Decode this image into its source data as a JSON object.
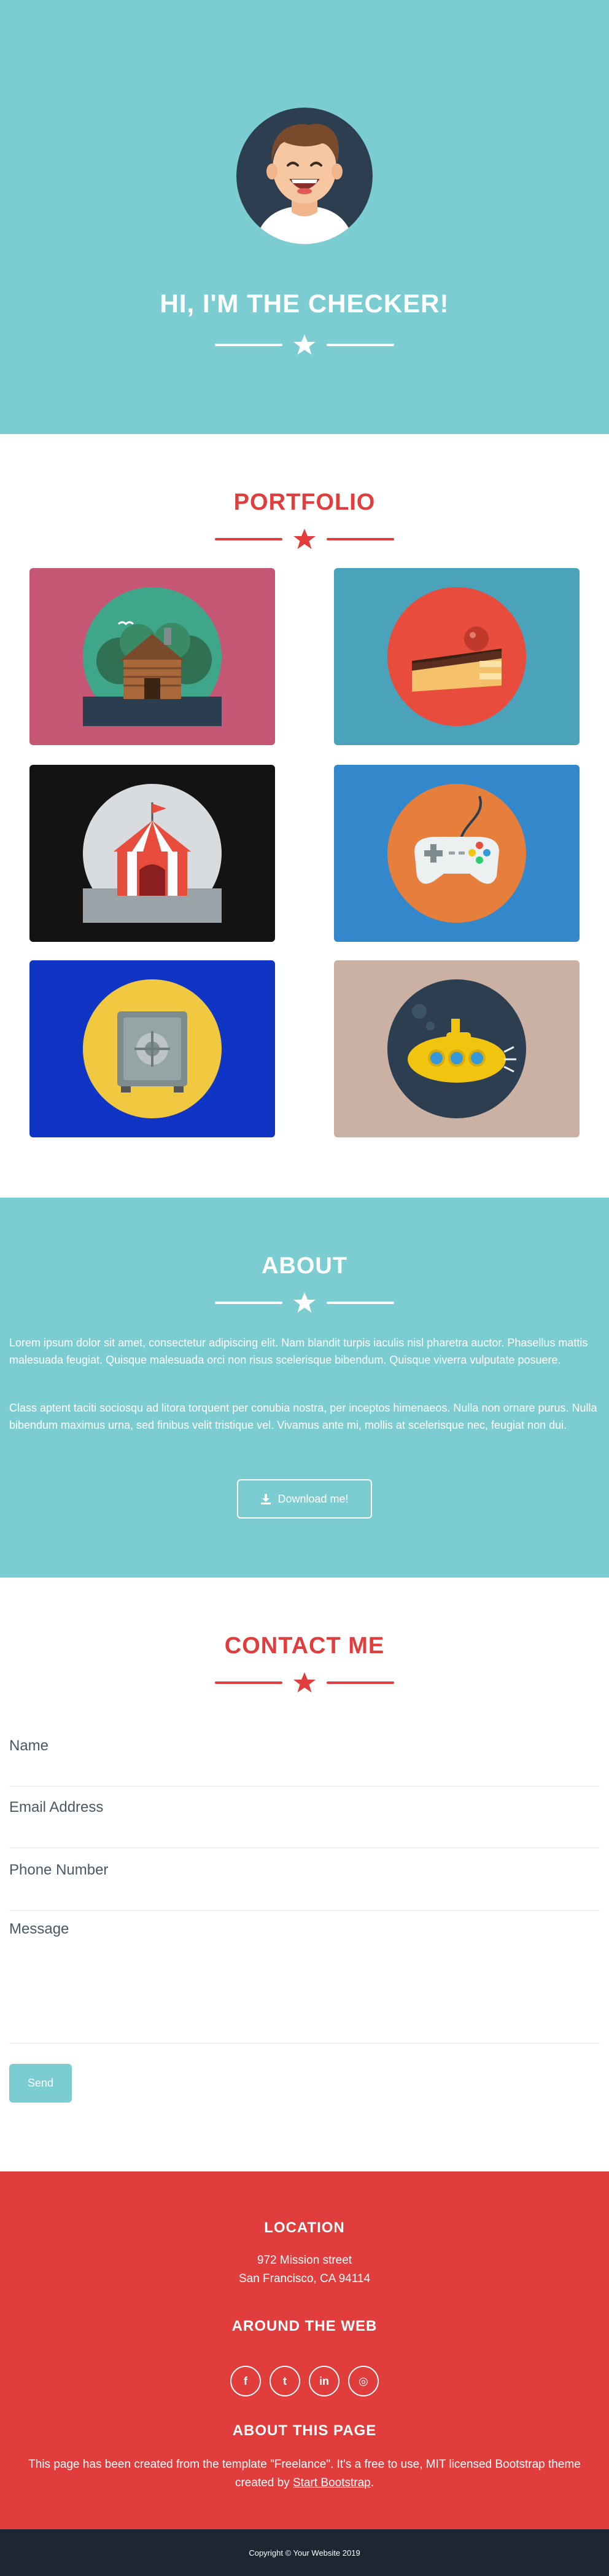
{
  "hero": {
    "title": "HI, I'M THE CHECKER!",
    "avatar_icon": "smiling-person-avatar",
    "bg_color": "#7ccdd1"
  },
  "portfolio": {
    "title": "PORTFOLIO",
    "accent_color": "#e23d3d",
    "items": [
      {
        "icon": "log-cabin-icon",
        "bg": "#c55674"
      },
      {
        "icon": "cake-slice-icon",
        "bg": "#4aa3ba"
      },
      {
        "icon": "circus-tent-icon",
        "bg": "#151212"
      },
      {
        "icon": "game-controller-icon",
        "bg": "#3388cc"
      },
      {
        "icon": "safe-icon",
        "bg": "#1034c3"
      },
      {
        "icon": "submarine-icon",
        "bg": "#cbb1a3"
      }
    ]
  },
  "about": {
    "title": "ABOUT",
    "p1": "Lorem ipsum dolor sit amet, consectetur adipiscing elit. Nam blandit turpis iaculis nisl pharetra auctor. Phasellus mattis malesuada feugiat. Quisque malesuada orci non risus scelerisque bibendum. Quisque viverra vulputate posuere.",
    "p2": "Class aptent taciti sociosqu ad litora torquent per conubia nostra, per inceptos himenaeos. Nulla non ornare purus. Nulla bibendum maximus urna, sed finibus velit tristique vel. Vivamus ante mi, mollis at scelerisque nec, feugiat non dui.",
    "download_label": "Download me!"
  },
  "contact": {
    "title": "CONTACT ME",
    "name_placeholder": "Name",
    "email_placeholder": "Email Address",
    "phone_placeholder": "Phone Number",
    "message_placeholder": "Message",
    "send_label": "Send"
  },
  "footer": {
    "location_title": "LOCATION",
    "address_line1": "972 Mission street",
    "address_line2": "San Francisco, CA 94114",
    "web_title": "AROUND THE WEB",
    "socials": [
      {
        "icon": "facebook-icon",
        "glyph": "f"
      },
      {
        "icon": "twitter-icon",
        "glyph": "t"
      },
      {
        "icon": "linkedin-icon",
        "glyph": "in"
      },
      {
        "icon": "dribbble-icon",
        "glyph": "◎"
      }
    ],
    "about_title": "ABOUT THIS PAGE",
    "about_text": "This page has been created from the template \"Freelance\". It's a free to use, MIT licensed Bootstrap theme created by",
    "about_link": "Start Bootstrap",
    "about_end": "."
  },
  "copyright": "Copyright © Your Website 2019"
}
